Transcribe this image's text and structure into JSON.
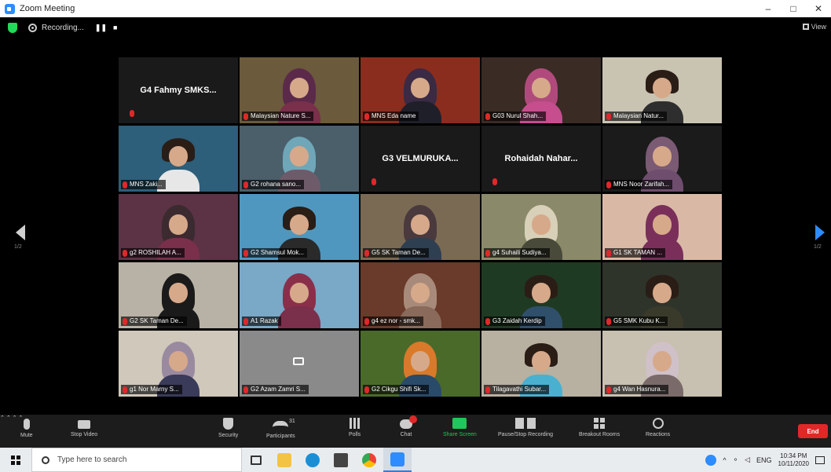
{
  "window": {
    "title": "Zoom Meeting",
    "minimize": "–",
    "maximize": "□",
    "close": "✕"
  },
  "topbar": {
    "recording_label": "Recording...",
    "pause": "❚❚",
    "stop": "■",
    "view_label": "View"
  },
  "gallery": {
    "tiles": [
      {
        "name": "G4 Fahmy SMKS...",
        "video": false,
        "active": false
      },
      {
        "name": "Malaysian Nature S...",
        "video": true,
        "active": true,
        "scene": "#6b5a3c",
        "wear": "#7a2f4a",
        "hijab": "#5b2a4a"
      },
      {
        "name": "MNS Eda name",
        "video": true,
        "active": false,
        "scene": "#8a2d1e",
        "wear": "#1f1f2a",
        "hijab": "#3a2a44"
      },
      {
        "name": "G03 Nurul Shah...",
        "video": true,
        "active": false,
        "scene": "#3a2b24",
        "wear": "#c64d8e",
        "hijab": "#b04a7c"
      },
      {
        "name": "Malaysian Natur...",
        "video": true,
        "active": false,
        "scene": "#c9c3b2",
        "wear": "#2e2e2e",
        "hijab": null
      },
      {
        "name": "MNS Zaki...",
        "video": true,
        "active": false,
        "scene": "#2d5e7a",
        "wear": "#e7e7e7",
        "hijab": null
      },
      {
        "name": "G2 rohana sano...",
        "video": true,
        "active": false,
        "scene": "#4a5f6a",
        "wear": "#6e5b6a",
        "hijab": "#6fa7b8"
      },
      {
        "name": "G3 VELMURUKA...",
        "video": false,
        "active": false
      },
      {
        "name": "Rohaidah Nahar...",
        "video": false,
        "active": false
      },
      {
        "name": "MNS Noor Zarifah...",
        "video": true,
        "active": false,
        "scene": "#1b1b1b",
        "wear": "#6e4d6e",
        "hijab": "#7b5a74"
      },
      {
        "name": "g2 ROSHILAH A...",
        "video": true,
        "active": false,
        "scene": "#5b3344",
        "wear": "#7a2f4a",
        "hijab": "#3b2a30"
      },
      {
        "name": "G2 Shamsul Mok...",
        "video": true,
        "active": false,
        "scene": "#4f97bf",
        "wear": "#2a2a2a",
        "hijab": null
      },
      {
        "name": "G5 SK Taman De...",
        "video": true,
        "active": false,
        "scene": "#7a6a54",
        "wear": "#2f3f52",
        "hijab": "#4a3a3e"
      },
      {
        "name": "g4 Suhaili Sudiya...",
        "video": true,
        "active": false,
        "scene": "#8a8a6a",
        "wear": "#4a4a3a",
        "hijab": "#d8d0b8"
      },
      {
        "name": "G1 SK TAMAN ...",
        "video": true,
        "active": false,
        "scene": "#d9b9a6",
        "wear": "#7a2f5a",
        "hijab": "#7a2f5a"
      },
      {
        "name": "G2 SK Taman De...",
        "video": true,
        "active": false,
        "scene": "#b8b2a6",
        "wear": "#1a1a1a",
        "hijab": "#1a1a1a"
      },
      {
        "name": "A1 Razak",
        "video": true,
        "active": false,
        "scene": "#7aa8c7",
        "wear": "#7a2f4a",
        "hijab": "#8a2f4a"
      },
      {
        "name": "g4 ez nor - smk...",
        "video": true,
        "active": false,
        "scene": "#6a3a2a",
        "wear": "#8a6a5a",
        "hijab": "#a88a7a"
      },
      {
        "name": "G3 Zaidah Kerdip",
        "video": true,
        "active": false,
        "scene": "#1f3a22",
        "wear": "#2f4f6a",
        "hijab": null
      },
      {
        "name": "G5 SMK Kubu K...",
        "video": true,
        "active": false,
        "scene": "#2f342a",
        "wear": "#3a3a2a",
        "hijab": null
      },
      {
        "name": "g1 Nor Marny S...",
        "video": true,
        "active": false,
        "scene": "#cfc8bb",
        "wear": "#3a3a5a",
        "hijab": "#9a8aa0"
      },
      {
        "name": "G2 Azam Zamri S...",
        "video": false,
        "active": false,
        "camoff": true
      },
      {
        "name": "G2 Cikgu Shifi Sk...",
        "video": true,
        "active": false,
        "scene": "#4a6a2a",
        "wear": "#2a4a6a",
        "hijab": "#d87a2a"
      },
      {
        "name": "Tilagavathi Subar...",
        "video": true,
        "active": false,
        "scene": "#b8b0a0",
        "wear": "#4ab0d0",
        "hijab": null
      },
      {
        "name": "g4 Wan Hasnura...",
        "video": true,
        "active": false,
        "scene": "#c8c0b0",
        "wear": "#7a6a6a",
        "hijab": "#d0c0c8"
      }
    ]
  },
  "pager": {
    "prev_label": "1/2",
    "next_label": "1/2"
  },
  "toolbar": {
    "mute": "Mute",
    "stop_video": "Stop Video",
    "security": "Security",
    "participants": "Participants",
    "participants_count": "31",
    "polls": "Polls",
    "chat": "Chat",
    "share_screen": "Share Screen",
    "record": "Pause/Stop Recording",
    "breakout": "Breakout Rooms",
    "reactions": "Reactions",
    "end": "End"
  },
  "taskbar": {
    "search_placeholder": "Type here to search",
    "lang": "ENG",
    "time": "10:34 PM",
    "date": "10/11/2020"
  }
}
